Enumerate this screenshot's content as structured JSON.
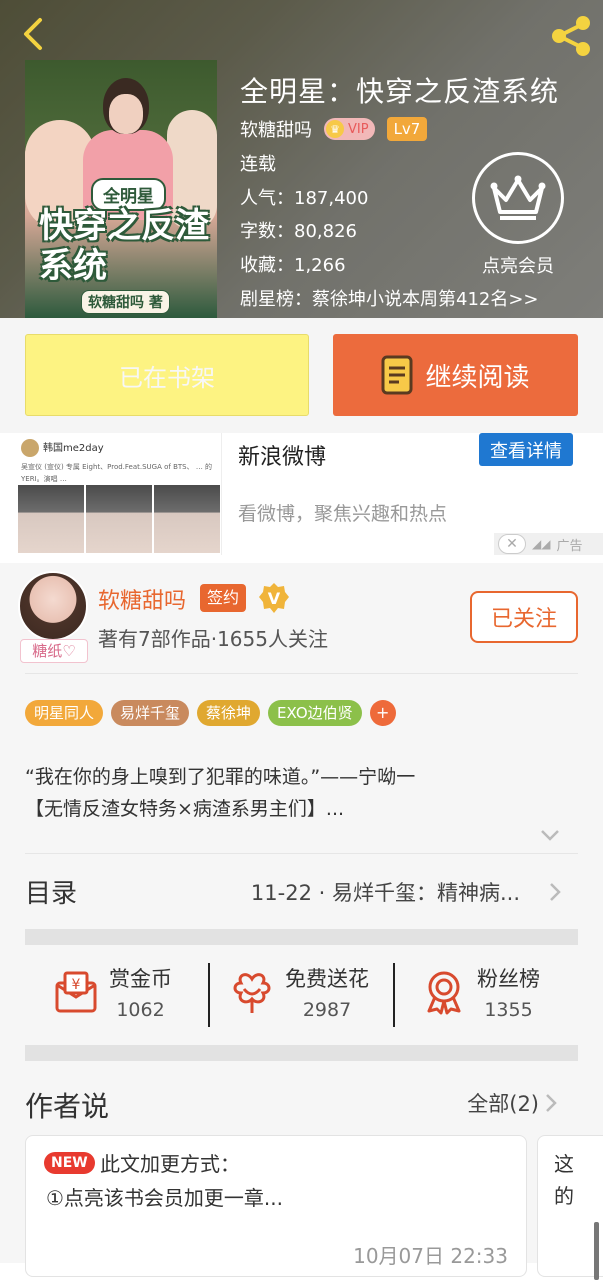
{
  "header": {
    "book_title": "全明星：快穿之反渣系统",
    "author": "软糖甜吗",
    "vip_label": "VIP",
    "level_label": "Lv7",
    "status": "连载",
    "popularity": "人气：187,400",
    "word_count": "字数：80,826",
    "favorites": "收藏：1,266",
    "ranking": "剧星榜：蔡徐坤小说本周第412名>>",
    "member_label": "点亮会员",
    "cover": {
      "small_title": "全明星",
      "big_title": "快穿之反渣系统",
      "author_tag": "软糖甜吗 著"
    }
  },
  "actions": {
    "shelf_label": "已在书架",
    "read_label": "继续阅读"
  },
  "ad": {
    "thumb_account": "韩国me2day",
    "thumb_text": "吴宣仪 (宣仪) 专属 Eight、Prod.Feat.SUGA of BTS、 … 的YERI。演唱 …",
    "title": "新浪微博",
    "detail_button": "查看详情",
    "description": "看微博，聚焦兴趣和热点",
    "ad_label": "广告"
  },
  "author_block": {
    "avatar_tag": "糖纸♡",
    "name": "软糖甜吗",
    "sign_label": "签约",
    "stats": "著有7部作品·1655人关注",
    "follow_label": "已关注",
    "tags": [
      {
        "label": "明星同人",
        "color": "#f2a83a"
      },
      {
        "label": "易烊千玺",
        "color": "#c98a5e"
      },
      {
        "label": "蔡徐坤",
        "color": "#e0a830"
      },
      {
        "label": "EXO边伯贤",
        "color": "#8cc04a"
      }
    ],
    "tag_add": "+",
    "intro_line1": "“我在你的身上嗅到了犯罪的味道。”——宁呦一",
    "intro_line2": "【无情反渣女特务×病渣系男主们】..."
  },
  "toc": {
    "label": "目录",
    "latest": "11-22 · 易烊千玺：精神病..."
  },
  "stats": [
    {
      "label": "赏金币",
      "value": "1062",
      "icon": "coin-envelope-icon"
    },
    {
      "label": "免费送花",
      "value": "2987",
      "icon": "flower-icon"
    },
    {
      "label": "粉丝榜",
      "value": "1355",
      "icon": "ribbon-medal-icon"
    }
  ],
  "author_say": {
    "title": "作者说",
    "all_label": "全部(2)",
    "notes": [
      {
        "badge": "NEW",
        "title": "此文加更方式：",
        "line": "①点亮该书会员加更一章...",
        "time": "10月07日  22:33"
      },
      {
        "line1": "这",
        "line2": "的"
      }
    ]
  },
  "colors": {
    "accent": "#e8672f",
    "read_button": "#ec6b3d",
    "shelf_button": "#fdf382",
    "ad_button": "#1f78d1"
  }
}
